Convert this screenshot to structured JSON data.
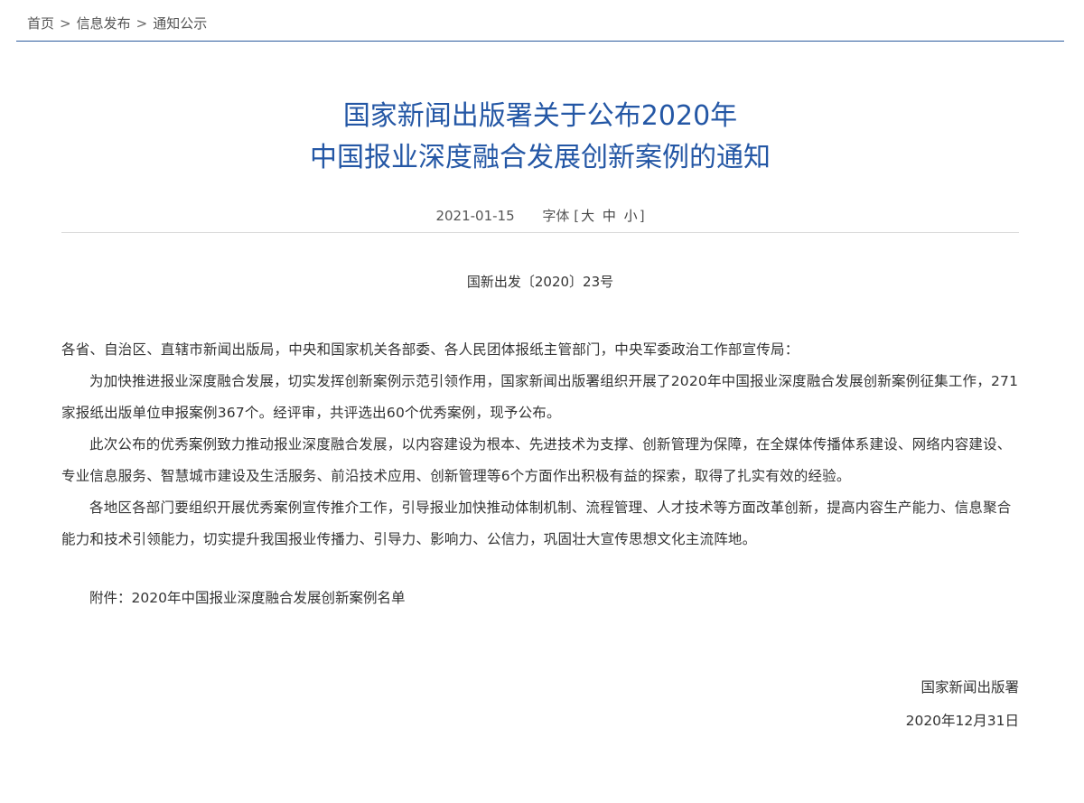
{
  "breadcrumb": {
    "items": [
      "首页",
      "信息发布",
      "通知公示"
    ],
    "separator": ">"
  },
  "article": {
    "title_line1": "国家新闻出版署关于公布2020年",
    "title_line2": "中国报业深度融合发展创新案例的通知",
    "date": "2021-01-15",
    "font_label": "字体",
    "font_open": "[",
    "font_close": "]",
    "font_sizes": [
      "大",
      "中",
      "小"
    ],
    "doc_number": "国新出发〔2020〕23号",
    "salutation": "各省、自治区、直辖市新闻出版局，中央和国家机关各部委、各人民团体报纸主管部门，中央军委政治工作部宣传局：",
    "paragraphs": [
      "为加快推进报业深度融合发展，切实发挥创新案例示范引领作用，国家新闻出版署组织开展了2020年中国报业深度融合发展创新案例征集工作，271家报纸出版单位申报案例367个。经评审，共评选出60个优秀案例，现予公布。",
      "此次公布的优秀案例致力推动报业深度融合发展，以内容建设为根本、先进技术为支撑、创新管理为保障，在全媒体传播体系建设、网络内容建设、专业信息服务、智慧城市建设及生活服务、前沿技术应用、创新管理等6个方面作出积极有益的探索，取得了扎实有效的经验。",
      "各地区各部门要组织开展优秀案例宣传推介工作，引导报业加快推动体制机制、流程管理、人才技术等方面改革创新，提高内容生产能力、信息聚合能力和技术引领能力，切实提升我国报业传播力、引导力、影响力、公信力，巩固壮大宣传思想文化主流阵地。"
    ],
    "attachment": "附件：2020年中国报业深度融合发展创新案例名单",
    "signature_org": "国家新闻出版署",
    "signature_date": "2020年12月31日"
  },
  "colors": {
    "title": "#2457a5",
    "rule": "#2d5c9e"
  }
}
